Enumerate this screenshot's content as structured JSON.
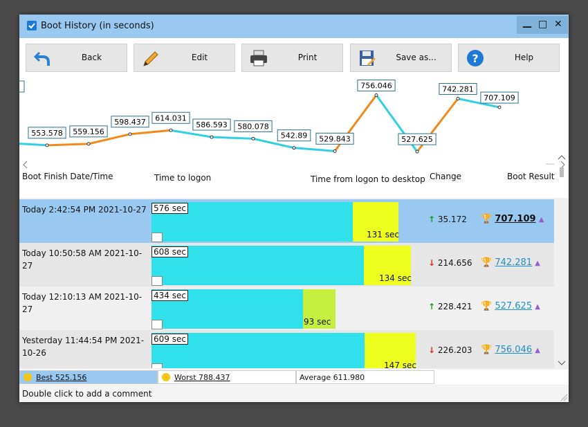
{
  "window": {
    "title": "Boot History (in seconds)"
  },
  "toolbar": {
    "back": "Back",
    "edit": "Edit",
    "print": "Print",
    "save": "Save as...",
    "help": "Help"
  },
  "chart": {
    "labels": [
      "553.578",
      "559.156",
      "598.437",
      "614.031",
      "586.593",
      "580.078",
      "542.89",
      "529.843",
      "756.046",
      "527.625",
      "742.281",
      "707.109"
    ]
  },
  "columns": {
    "date": "Boot Finish Date/Time",
    "logon": "Time to logon",
    "desktop": "Time from logon to desktop",
    "change": "Change",
    "result": "Boot Result"
  },
  "rows": [
    {
      "date": "Today  2:42:54 PM 2021-10-27",
      "logon": "576 sec",
      "desktop": "131 sec",
      "change": "35.172",
      "result": "707.109"
    },
    {
      "date": "Today  10:50:58 AM 2021-10-27",
      "logon": "608 sec",
      "desktop": "134 sec",
      "change": "214.656",
      "result": "742.281"
    },
    {
      "date": "Today  12:10:13 AM 2021-10-27",
      "logon": "434 sec",
      "desktop": "93 sec",
      "change": "228.421",
      "result": "527.625"
    },
    {
      "date": "Yesterday  11:44:54 PM 2021-10-26",
      "logon": "609 sec",
      "desktop": "147 sec",
      "change": "226.203",
      "result": "756.046"
    }
  ],
  "status": {
    "best": "Best 525.156",
    "worst": "Worst 788.437",
    "average": "Average 611.980"
  },
  "footer": {
    "hint": "Double click to add a comment"
  },
  "colors": {
    "logon": "#30e0ea",
    "desktop": "#eeff20",
    "desktop_short": "#c6f040",
    "selected": "#99c9f0",
    "up": "#1a9e1a",
    "down": "#d83010",
    "trend_up": "#f08a1a",
    "trend_down": "#30d0e0"
  }
}
